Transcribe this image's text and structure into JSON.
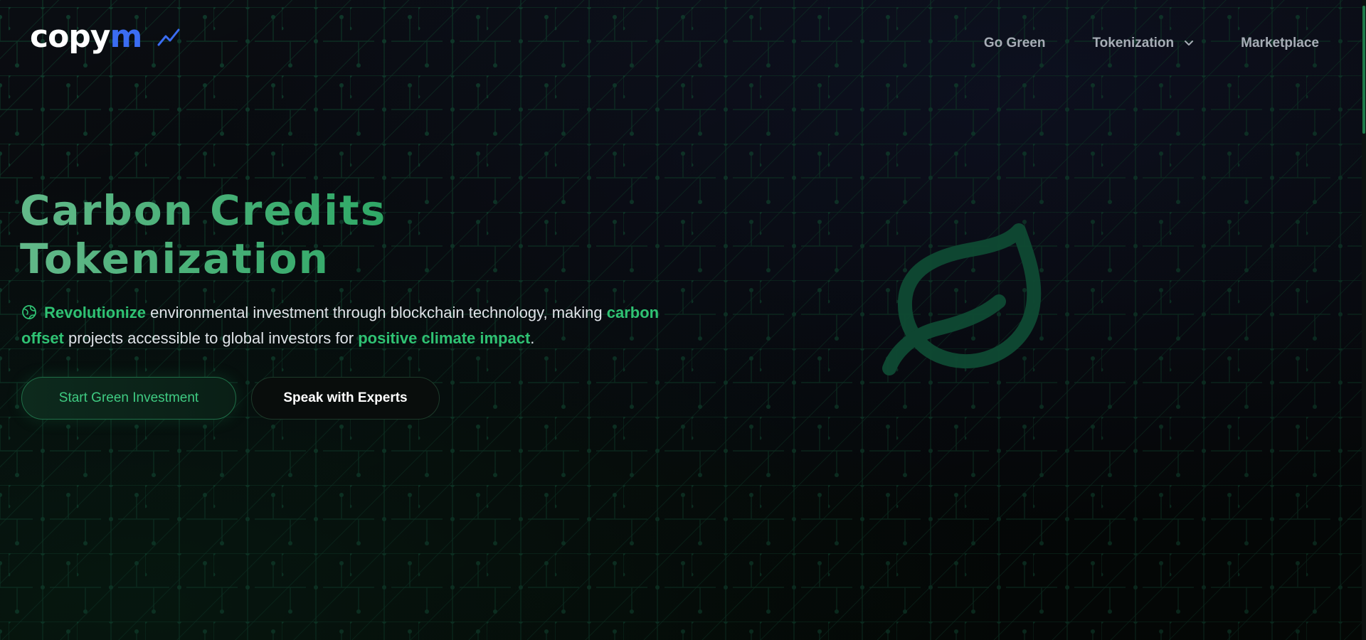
{
  "brand": {
    "logo_main": "copy",
    "logo_accent": "m",
    "accent_color": "#3b6df2"
  },
  "nav": {
    "items": [
      {
        "label": "Go Green"
      },
      {
        "label": "Tokenization",
        "has_dropdown": true
      },
      {
        "label": "Marketplace"
      }
    ]
  },
  "hero": {
    "title_line1": "Carbon Credits",
    "title_line2": "Tokenization",
    "description": {
      "hl1": "Revolutionize",
      "text1": " environmental investment through blockchain technology, making ",
      "hl2": "carbon offset",
      "text2": " projects accessible to global investors for ",
      "hl3": "positive climate impact",
      "text3": "."
    },
    "primary_button": "Start Green Investment",
    "secondary_button": "Speak with Experts"
  },
  "colors": {
    "background": "#070a0c",
    "green_accent": "#2fc273",
    "title_green": "#4fb37a",
    "nav_text": "#a7adb6"
  },
  "icons": {
    "logo": "trend-up-icon",
    "description": "globe-leaf-icon",
    "hero_art": "leaf-icon",
    "dropdown": "chevron-down-icon"
  }
}
